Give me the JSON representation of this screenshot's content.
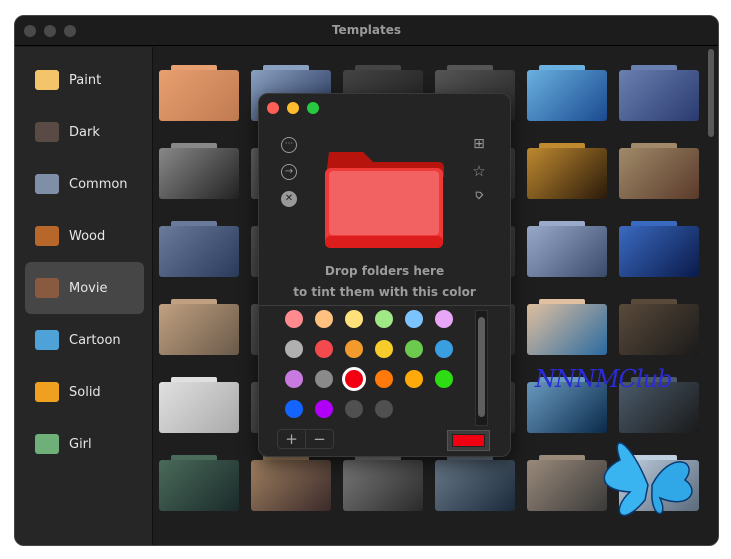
{
  "window": {
    "title": "Templates"
  },
  "sidebar": {
    "items": [
      {
        "label": "Paint",
        "color": "#f3c46a"
      },
      {
        "label": "Dark",
        "color": "#5a4a45"
      },
      {
        "label": "Common",
        "color": "#7f8fa8"
      },
      {
        "label": "Wood",
        "color": "#b8672a"
      },
      {
        "label": "Movie",
        "color": "#8a5a40"
      },
      {
        "label": "Cartoon",
        "color": "#4fa2d8"
      },
      {
        "label": "Solid",
        "color": "#f0a020"
      },
      {
        "label": "Girl",
        "color": "#6fb07a"
      }
    ],
    "selected": "Movie"
  },
  "panel": {
    "drop_line1": "Drop folders here",
    "drop_line2": "to tint them with this color",
    "add_label": "+",
    "remove_label": "−",
    "current_color": "#f00010",
    "swatches": [
      "#ff8a8f",
      "#ffc080",
      "#ffe07a",
      "#a0e886",
      "#7cc4ff",
      "#e8a6f8",
      "#b0b0b0",
      "#f24a4d",
      "#f29a2e",
      "#f8cc2a",
      "#6ccb4e",
      "#3a9fe0",
      "#c87ae0",
      "#8a8a8a",
      "#f00010",
      "#ff7a0a",
      "#ffaa0a",
      "#2edc14",
      "#1464ff",
      "#b000f8",
      "#505050",
      "#505050"
    ],
    "selected_index": 14
  },
  "watermark": "NNNMClub"
}
